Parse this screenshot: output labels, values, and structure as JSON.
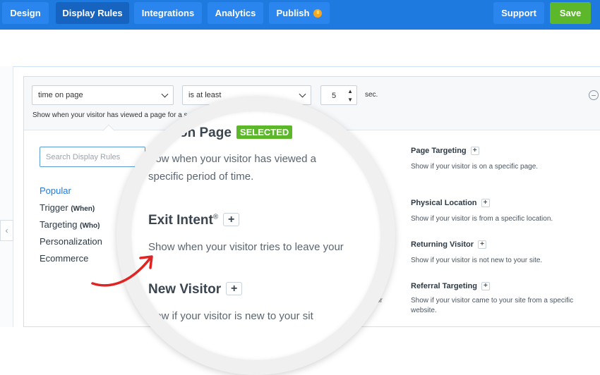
{
  "topbar": {
    "tabs": [
      {
        "label": "Design"
      },
      {
        "label": "Display Rules"
      },
      {
        "label": "Integrations"
      },
      {
        "label": "Analytics"
      },
      {
        "label": "Publish",
        "badge": "II"
      }
    ],
    "support_label": "Support",
    "save_label": "Save"
  },
  "rule": {
    "condition": "time on page",
    "operator": "is at least",
    "value": "5",
    "unit": "sec.",
    "description": "Show when your visitor has viewed a page for a s"
  },
  "search": {
    "placeholder": "Search Display Rules"
  },
  "categories": [
    {
      "label": "Popular",
      "sub": ""
    },
    {
      "label": "Trigger",
      "sub": "(When)"
    },
    {
      "label": "Targeting",
      "sub": "(Who)"
    },
    {
      "label": "Personalization",
      "sub": ""
    },
    {
      "label": "Ecommerce",
      "sub": ""
    }
  ],
  "right_rules": [
    {
      "title": "Page Targeting",
      "desc": "Show if your visitor is on a specific page."
    },
    {
      "title": "Physical Location",
      "desc": "Show if your visitor is from a specific location."
    },
    {
      "title": "Returning Visitor",
      "desc": "Show if your visitor is not new to your site."
    },
    {
      "title": "Referral Targeting",
      "desc": "Show if your visitor came to your site from a specific website."
    }
  ],
  "partial_text": "or",
  "magnifier": {
    "time_title": "on Page",
    "selected_badge": "SELECTED",
    "time_desc_1": "how when your visitor has viewed a",
    "time_desc_2": "specific period of time.",
    "exit_title": "Exit Intent",
    "exit_reg": "®",
    "exit_desc": "Show when your visitor tries to leave your",
    "new_title": "New Visitor",
    "new_desc": "how if your visitor is new to your sit"
  },
  "colors": {
    "brand_blue": "#1f7ae0",
    "save_green": "#5cb82a",
    "badge_orange": "#f5a623",
    "arrow_red": "#e02424"
  }
}
